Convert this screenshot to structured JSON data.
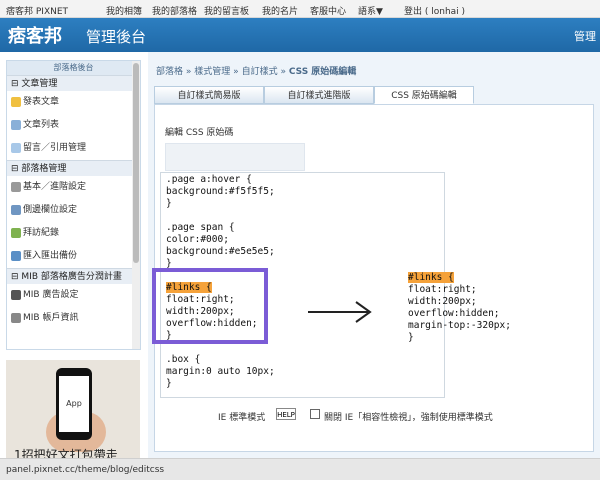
{
  "topbar": {
    "items": [
      "痞客邦 PIXNET",
      "我的相簿",
      "我的部落格",
      "我的留言板",
      "我的名片",
      "客服中心",
      "語系▼",
      "登出 ( lonhai )"
    ]
  },
  "header": {
    "logo": "痞客邦",
    "title": "管理後台",
    "right_text": "管理"
  },
  "sidebar": {
    "title": "部落格後台",
    "sections": [
      {
        "label": "文章管理",
        "items": [
          "發表文章",
          "文章列表",
          "留言／引用管理"
        ]
      },
      {
        "label": "部落格管理",
        "items": [
          "基本／進階設定",
          "側邊欄位設定",
          "拜訪紀錄",
          "匯入匯出備份"
        ]
      },
      {
        "label": "MIB 部落格廣告分潤計畫",
        "items": [
          "MIB 廣告設定",
          "MIB 帳戶資訊"
        ]
      }
    ]
  },
  "ad": {
    "phone_text": "App",
    "headline": "1招把好文打包帶走"
  },
  "breadcrumb": {
    "items": [
      "部落格",
      "樣式管理",
      "自訂樣式",
      "CSS 原始碼編輯"
    ],
    "separator": "»"
  },
  "tabs": [
    {
      "label": "自訂樣式簡易版",
      "active": false
    },
    {
      "label": "自訂樣式進階版",
      "active": false
    },
    {
      "label": "CSS 原始碼編輯",
      "active": true
    }
  ],
  "panel": {
    "title": "編輯 CSS 原始碼"
  },
  "css_lines": [
    ".page a:hover {",
    "background:#f5f5f5;",
    "}",
    "",
    ".page span {",
    "color:#000;",
    "background:#e5e5e5;",
    "}",
    "",
    "#links {",
    "float:right;",
    "width:200px;",
    "overflow:hidden;",
    "}",
    "",
    ".box {",
    "margin:0 auto 10px;",
    "}"
  ],
  "snippet_lines": [
    "#links {",
    "float:right;",
    "width:200px;",
    "overflow:hidden;",
    "margin-top:-320px;",
    "}"
  ],
  "ie": {
    "label": "IE 標準模式",
    "help": "HELP",
    "checkbox_text": "關閉 IE「相容性檢視」，強制使用標準模式",
    "checked": false
  },
  "status_bar": {
    "url": "panel.pixnet.cc/theme/blog/editcss"
  },
  "colors": {
    "header_blue": "#2d7fc1",
    "highlight_orange": "#f5a23a",
    "frame_purple": "#7b5cd6"
  }
}
